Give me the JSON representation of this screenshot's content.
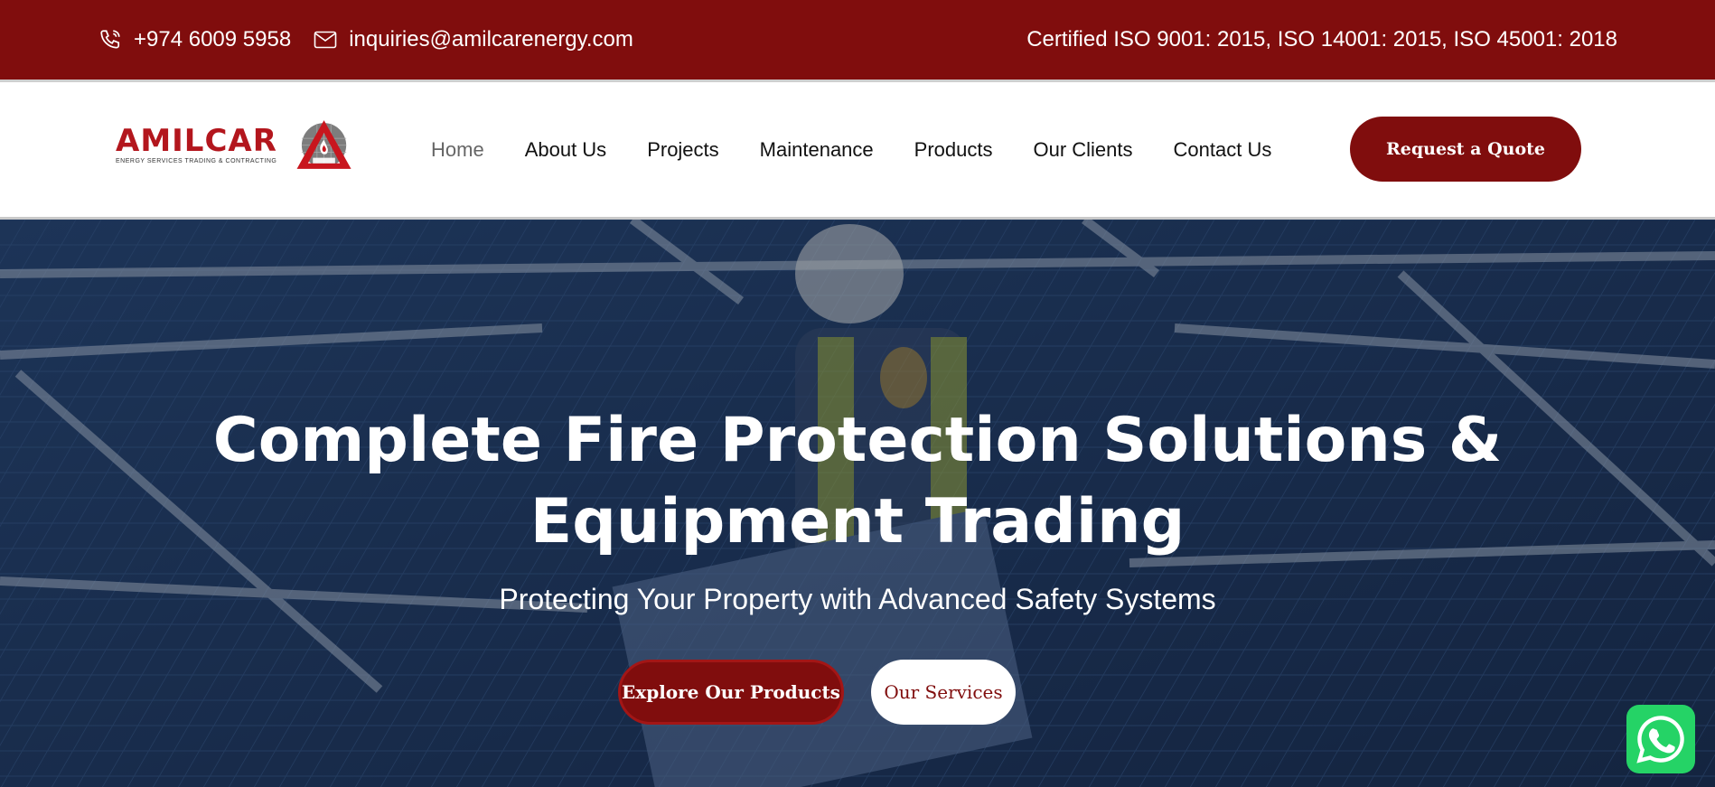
{
  "topbar": {
    "phone": "+974 6009 5958",
    "email": "inquiries@amilcarenergy.com",
    "certification": "Certified  ISO 9001: 2015, ISO 14001: 2015, ISO 45001: 2018",
    "icons": {
      "phone": "phone-icon",
      "email": "mail-icon"
    },
    "background_color": "#800d0d"
  },
  "logo": {
    "name": "AMILCAR",
    "tagline": "ENERGY SERVICES TRADING & CONTRACTING",
    "brand_color": "#b3161d"
  },
  "nav": {
    "items": [
      {
        "label": "Home",
        "active": true
      },
      {
        "label": "About Us"
      },
      {
        "label": "Projects"
      },
      {
        "label": "Maintenance"
      },
      {
        "label": "Products"
      },
      {
        "label": "Our Clients"
      },
      {
        "label": "Contact Us"
      }
    ]
  },
  "header": {
    "quote_button": "Request a Quote"
  },
  "hero": {
    "title_line1": "Complete Fire Protection Solutions &",
    "title_line2": "Equipment Trading",
    "subtitle": "Protecting Your Property with Advanced Safety Systems",
    "primary_button": "Explore Our Products",
    "secondary_button": "Our Services"
  },
  "floating": {
    "whatsapp_icon": "whatsapp-icon",
    "whatsapp_color": "#25d366"
  }
}
